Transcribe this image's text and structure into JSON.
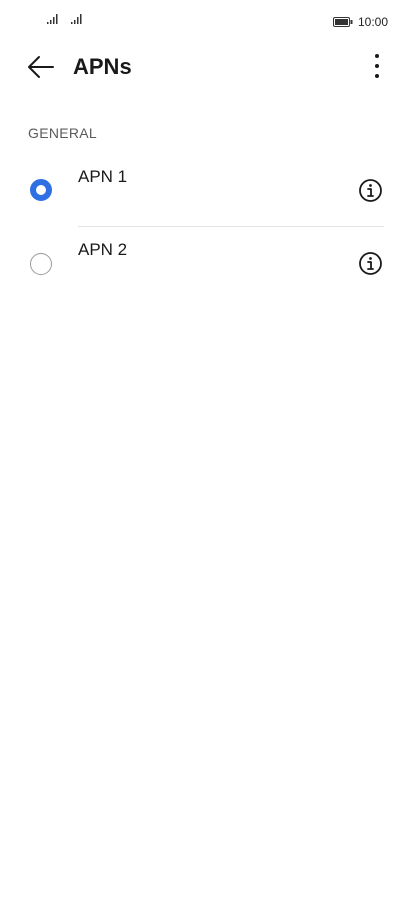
{
  "status_bar": {
    "time": "10:00",
    "icons": [
      "signal-icon",
      "signal-icon",
      "battery-icon"
    ]
  },
  "app_bar": {
    "title": "APNs",
    "back_icon": "arrow-left-icon",
    "more_icon": "more-vertical-icon"
  },
  "section": {
    "header": "GENERAL"
  },
  "apns": [
    {
      "label": "APN 1",
      "selected": true
    },
    {
      "label": "APN 2",
      "selected": false
    }
  ],
  "colors": {
    "accent": "#2f6fe4",
    "text_primary": "#1a1a1a",
    "text_secondary": "#5b5b5b",
    "divider": "#e3e3e3"
  }
}
